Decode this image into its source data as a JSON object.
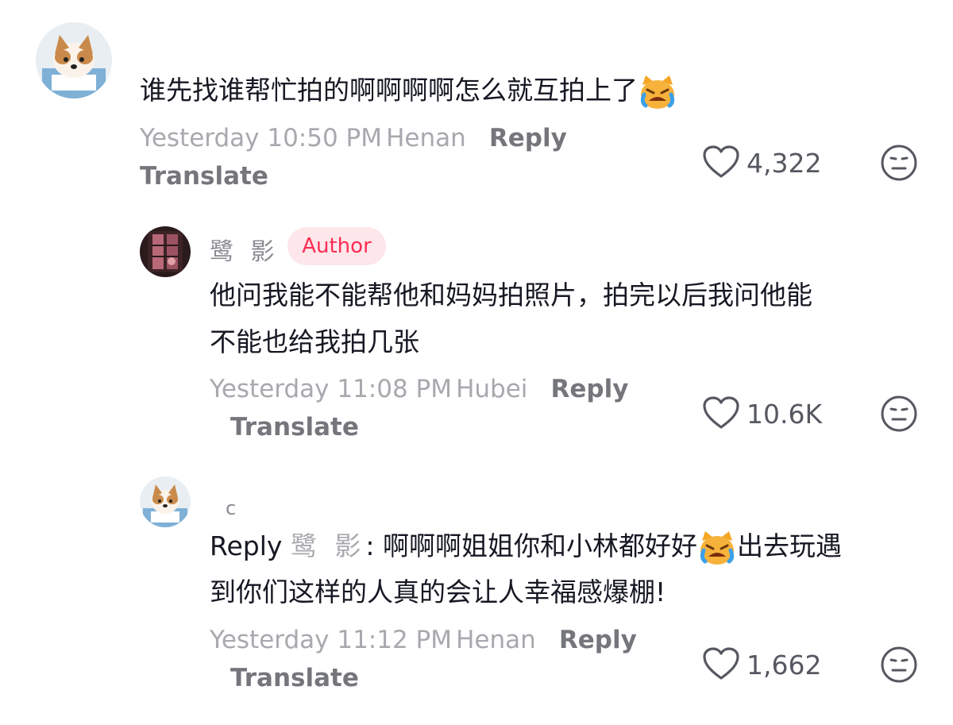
{
  "comments": [
    {
      "text_line1": "谁先找谁帮忙拍的啊啊啊啊怎么就互拍上了",
      "emoji": "crying-cat-emoji",
      "time": "Yesterday 10:50 PM",
      "location": "Henan",
      "reply_label": "Reply",
      "translate_label": "Translate",
      "likes": "4,322"
    },
    {
      "username": "鹭 影",
      "badge": "Author",
      "text_line1": "他问我能不能帮他和妈妈拍照片，拍完以后我问他能",
      "text_line2": "不能也给我拍几张",
      "time": "Yesterday 11:08 PM",
      "location": "Hubei",
      "reply_label": "Reply",
      "translate_label": "Translate",
      "likes": "10.6K"
    },
    {
      "username": "c",
      "reply_prefix": "Reply",
      "reply_to": "鹭 影",
      "text_line1_a": ": 啊啊啊姐姐你和小林都好好",
      "text_line1_b": "出去玩遇",
      "text_line2": "到你们这样的人真的会让人幸福感爆棚!",
      "emoji": "crying-cat-emoji",
      "time": "Yesterday 11:12 PM",
      "location": "Henan",
      "reply_label": "Reply",
      "translate_label": "Translate",
      "likes": "1,662"
    }
  ],
  "icons": {
    "like": "heart-outline-icon",
    "dislike": "neutral-face-icon"
  },
  "colors": {
    "author_badge_bg": "#fde7ea",
    "author_badge_text": "#fe2c55",
    "meta_gray": "#a8a9ae",
    "action_gray": "#75767c"
  }
}
